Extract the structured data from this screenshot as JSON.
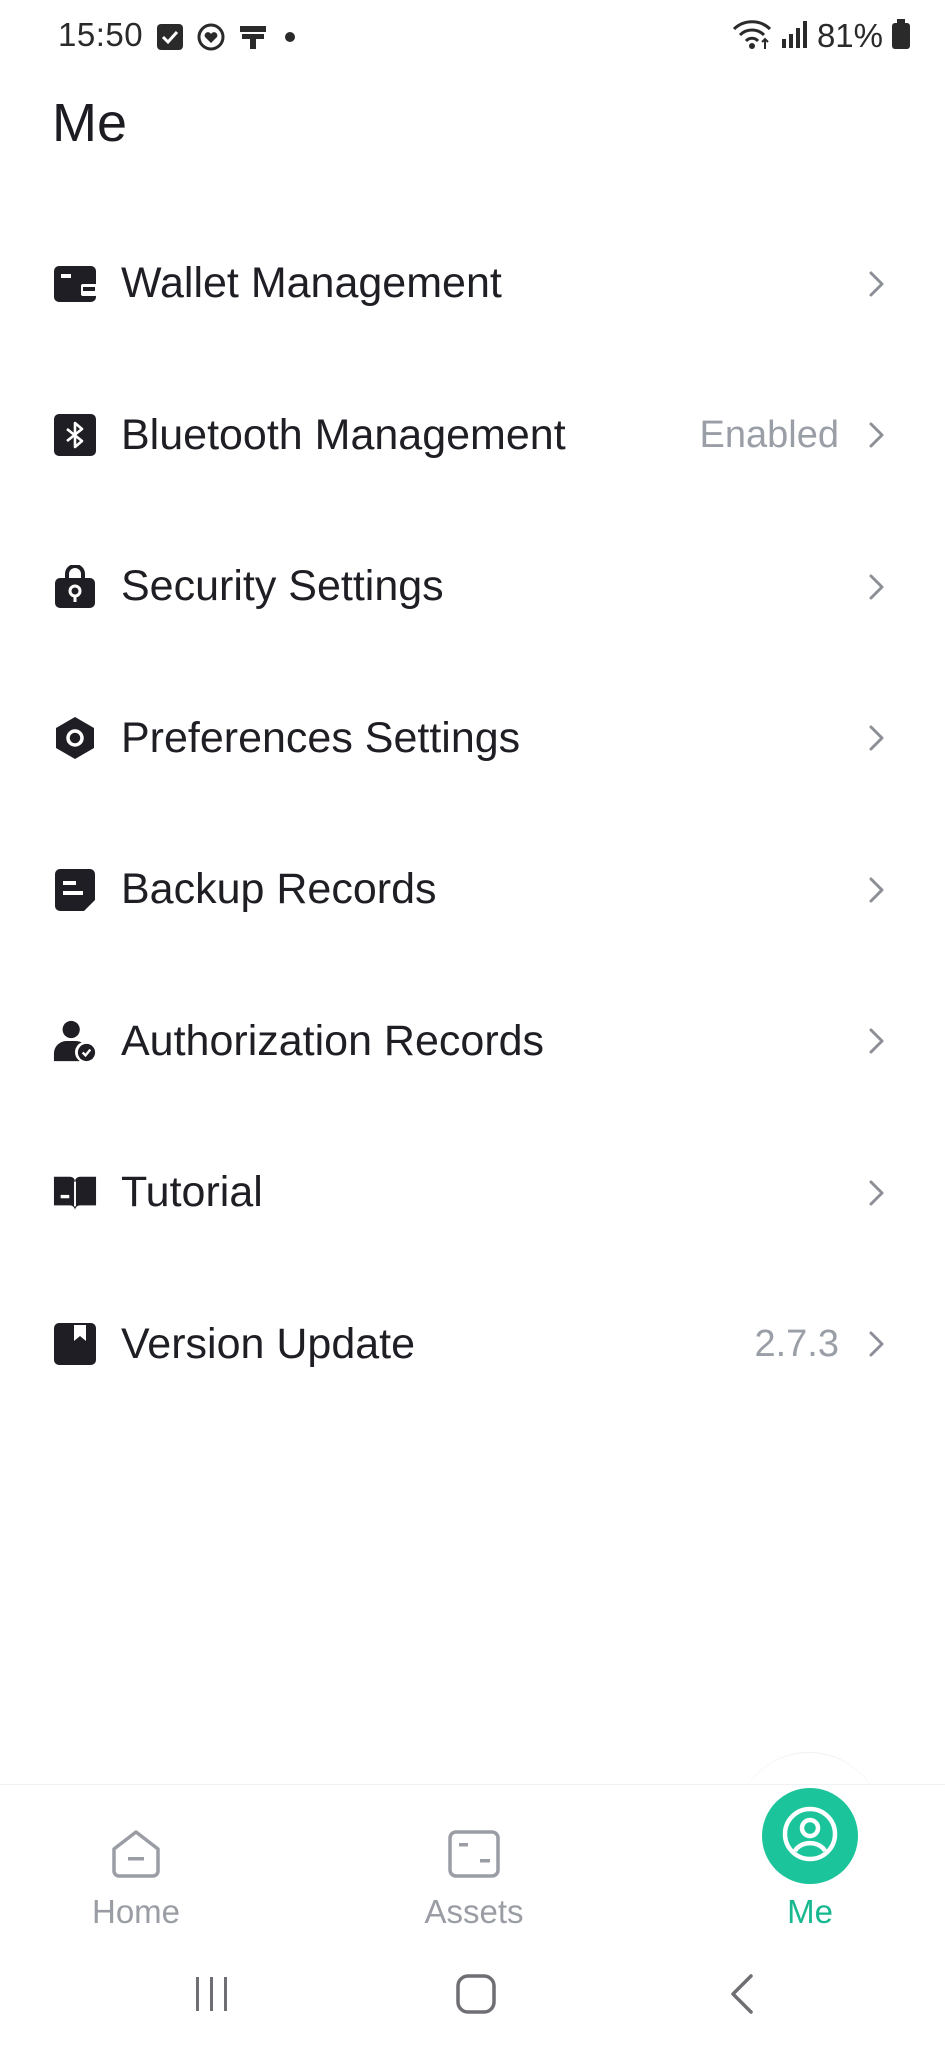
{
  "status_bar": {
    "time": "15:50",
    "battery": "81%",
    "icons": [
      "checkbox-notification-icon",
      "heart-app-icon",
      "bank-app-icon",
      "dot-indicator-icon",
      "wifi-icon",
      "signal-icon",
      "battery-icon"
    ]
  },
  "page": {
    "title": "Me"
  },
  "menu": {
    "items": [
      {
        "label": "Wallet Management",
        "value": "",
        "icon": "wallet-icon"
      },
      {
        "label": "Bluetooth Management",
        "value": "Enabled",
        "icon": "bluetooth-icon"
      },
      {
        "label": "Security Settings",
        "value": "",
        "icon": "lock-icon"
      },
      {
        "label": "Preferences Settings",
        "value": "",
        "icon": "hexagon-settings-icon"
      },
      {
        "label": "Backup Records",
        "value": "",
        "icon": "document-icon"
      },
      {
        "label": "Authorization Records",
        "value": "",
        "icon": "user-check-icon"
      },
      {
        "label": "Tutorial",
        "value": "",
        "icon": "book-icon"
      },
      {
        "label": "Version Update",
        "value": "2.7.3",
        "icon": "bookmark-icon"
      }
    ]
  },
  "bottom_nav": {
    "items": [
      {
        "label": "Home",
        "icon": "home-icon",
        "active": false
      },
      {
        "label": "Assets",
        "icon": "assets-icon",
        "active": false
      },
      {
        "label": "Me",
        "icon": "user-circle-icon",
        "active": true
      }
    ],
    "active_color": "#17b890",
    "inactive_color": "#9a9da4"
  },
  "system_nav": {
    "buttons": [
      "recents-icon",
      "home-square-icon",
      "back-icon"
    ]
  }
}
